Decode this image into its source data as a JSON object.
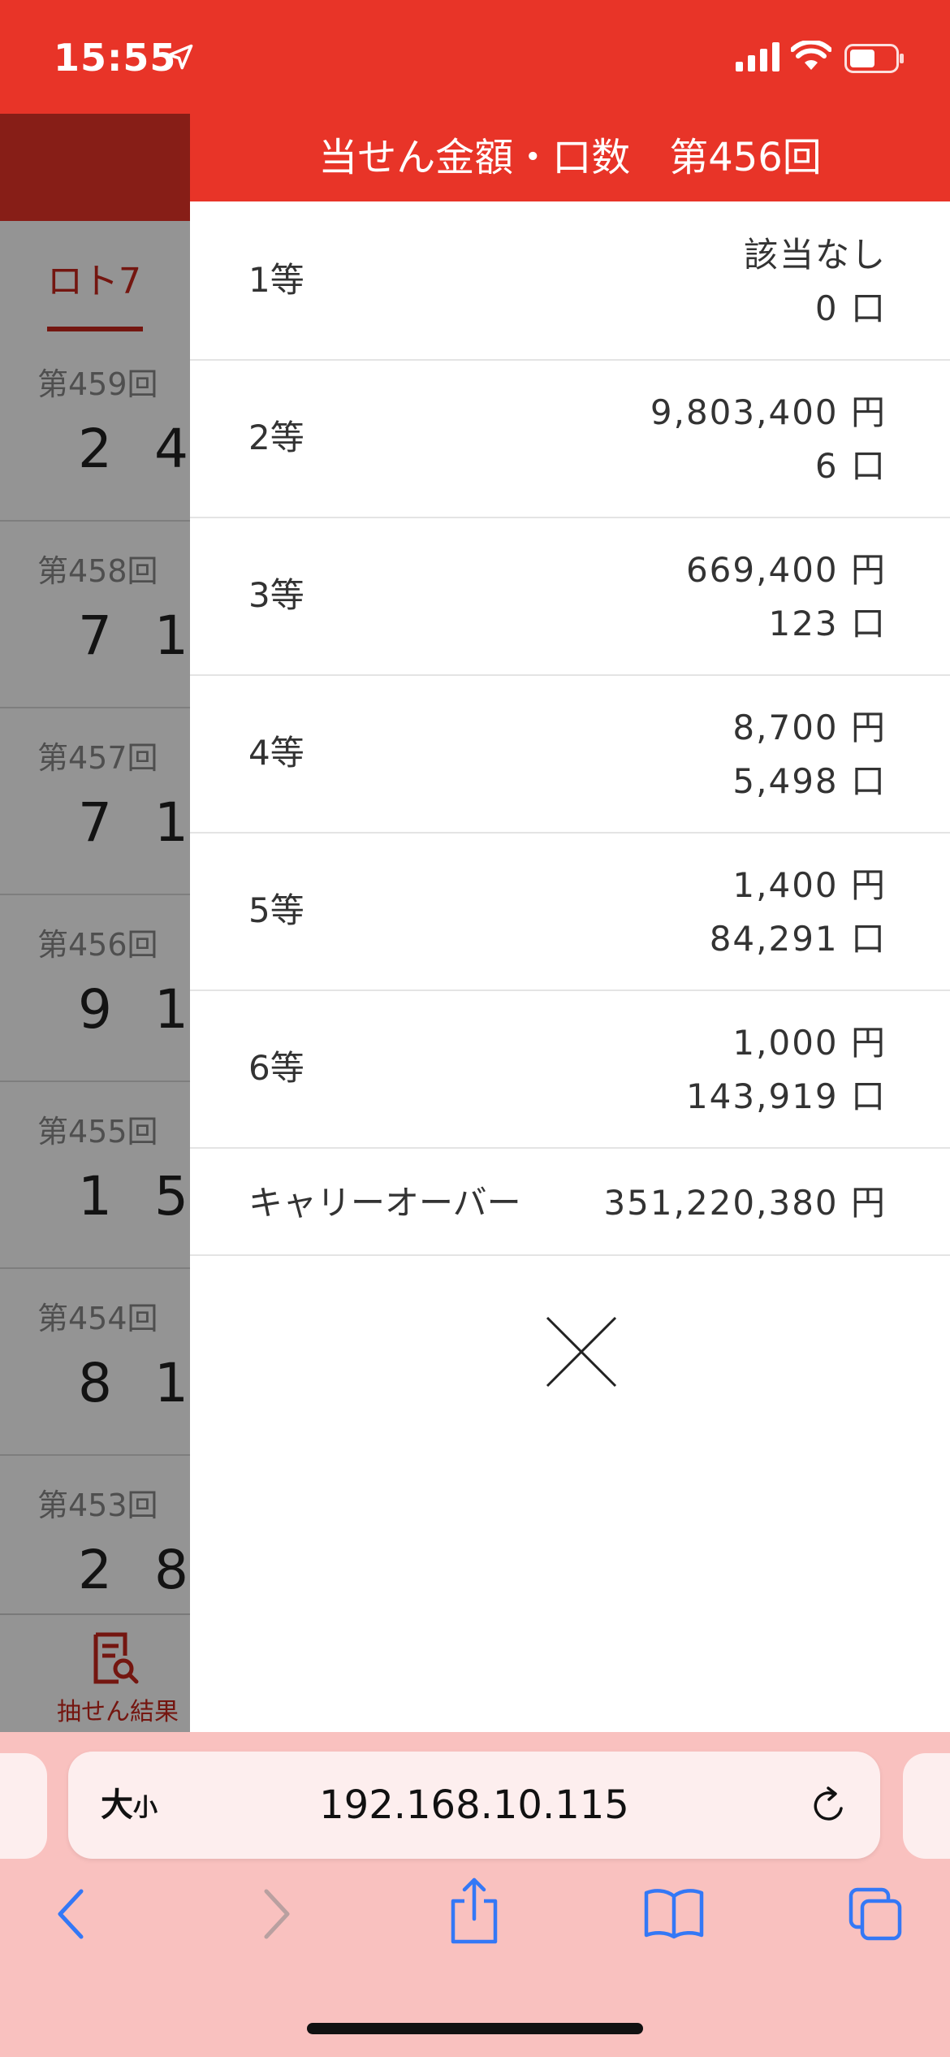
{
  "status_bar": {
    "time": "15:55",
    "icons": [
      "location-arrow-icon",
      "cellular-signal-icon",
      "wifi-icon",
      "battery-icon"
    ]
  },
  "background": {
    "tab_label": "ロト7",
    "draws": [
      {
        "label": "第459回",
        "n1": "2",
        "n2": "4"
      },
      {
        "label": "第458回",
        "n1": "7",
        "n2": "1"
      },
      {
        "label": "第457回",
        "n1": "7",
        "n2": "1"
      },
      {
        "label": "第456回",
        "n1": "9",
        "n2": "1"
      },
      {
        "label": "第455回",
        "n1": "1",
        "n2": "5"
      },
      {
        "label": "第454回",
        "n1": "8",
        "n2": "1"
      },
      {
        "label": "第453回",
        "n1": "2",
        "n2": "8"
      }
    ],
    "tabbar_label": "抽せん結果"
  },
  "modal": {
    "title": "当せん金額・口数　第456回",
    "prizes": [
      {
        "rank": "1等",
        "amount": "該当なし",
        "count": "0 口"
      },
      {
        "rank": "2等",
        "amount": "9,803,400 円",
        "count": "6 口"
      },
      {
        "rank": "3等",
        "amount": "669,400 円",
        "count": "123 口"
      },
      {
        "rank": "4等",
        "amount": "8,700 円",
        "count": "5,498 口"
      },
      {
        "rank": "5等",
        "amount": "1,400 円",
        "count": "84,291 口"
      },
      {
        "rank": "6等",
        "amount": "1,000 円",
        "count": "143,919 口"
      }
    ],
    "carryover": {
      "label": "キャリーオーバー",
      "value": "351,220,380 円"
    }
  },
  "browser": {
    "size_label_large": "大",
    "size_label_small": "小",
    "url": "192.168.10.115"
  },
  "colors": {
    "accent": "#e83428",
    "toolbar": "#f9c1bf",
    "icon_blue": "#3478f6"
  }
}
